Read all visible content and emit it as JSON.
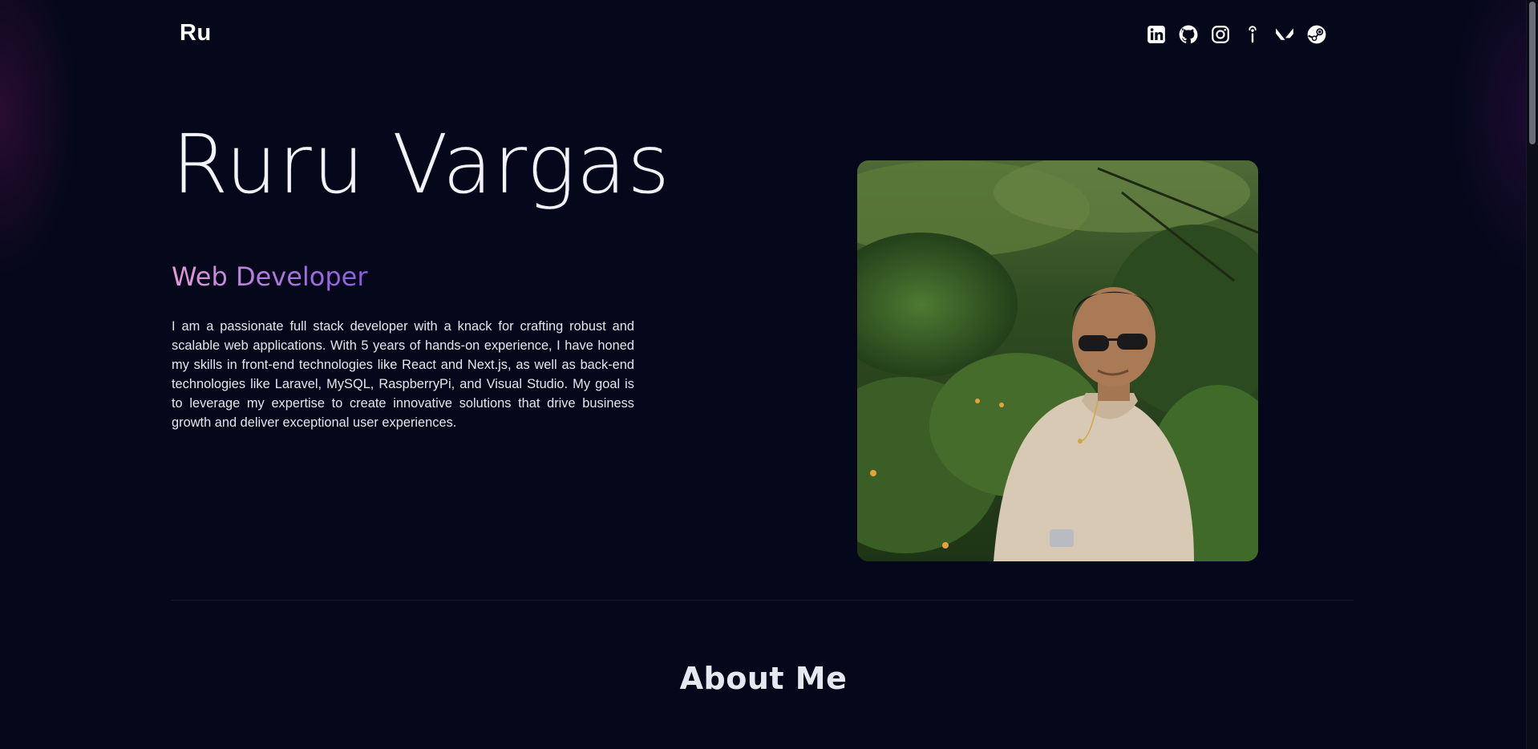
{
  "header": {
    "brand": "Ru",
    "socials": [
      {
        "icon": "linkedin-icon"
      },
      {
        "icon": "github-icon"
      },
      {
        "icon": "instagram-icon"
      },
      {
        "icon": "ideas-icon"
      },
      {
        "icon": "valorant-icon"
      },
      {
        "icon": "steam-icon"
      }
    ]
  },
  "hero": {
    "name": "Ruru Vargas",
    "role": "Web Developer",
    "description": "I am a passionate full stack developer with a knack for crafting robust and scalable web applications. With 5 years of hands-on experience, I have honed my skills in front-end technologies like React and Next.js, as well as back-end technologies like Laravel, MySQL, RaspberryPi, and Visual Studio. My goal is to leverage my expertise to create innovative solutions that drive business growth and deliver exceptional user experiences.",
    "photo": "profile-photo"
  },
  "about": {
    "title": "About Me"
  },
  "colors": {
    "background": "#04081a",
    "gradient_start": "#e79ad7",
    "gradient_end": "#8a5be0",
    "text": "#e6e8f0"
  }
}
